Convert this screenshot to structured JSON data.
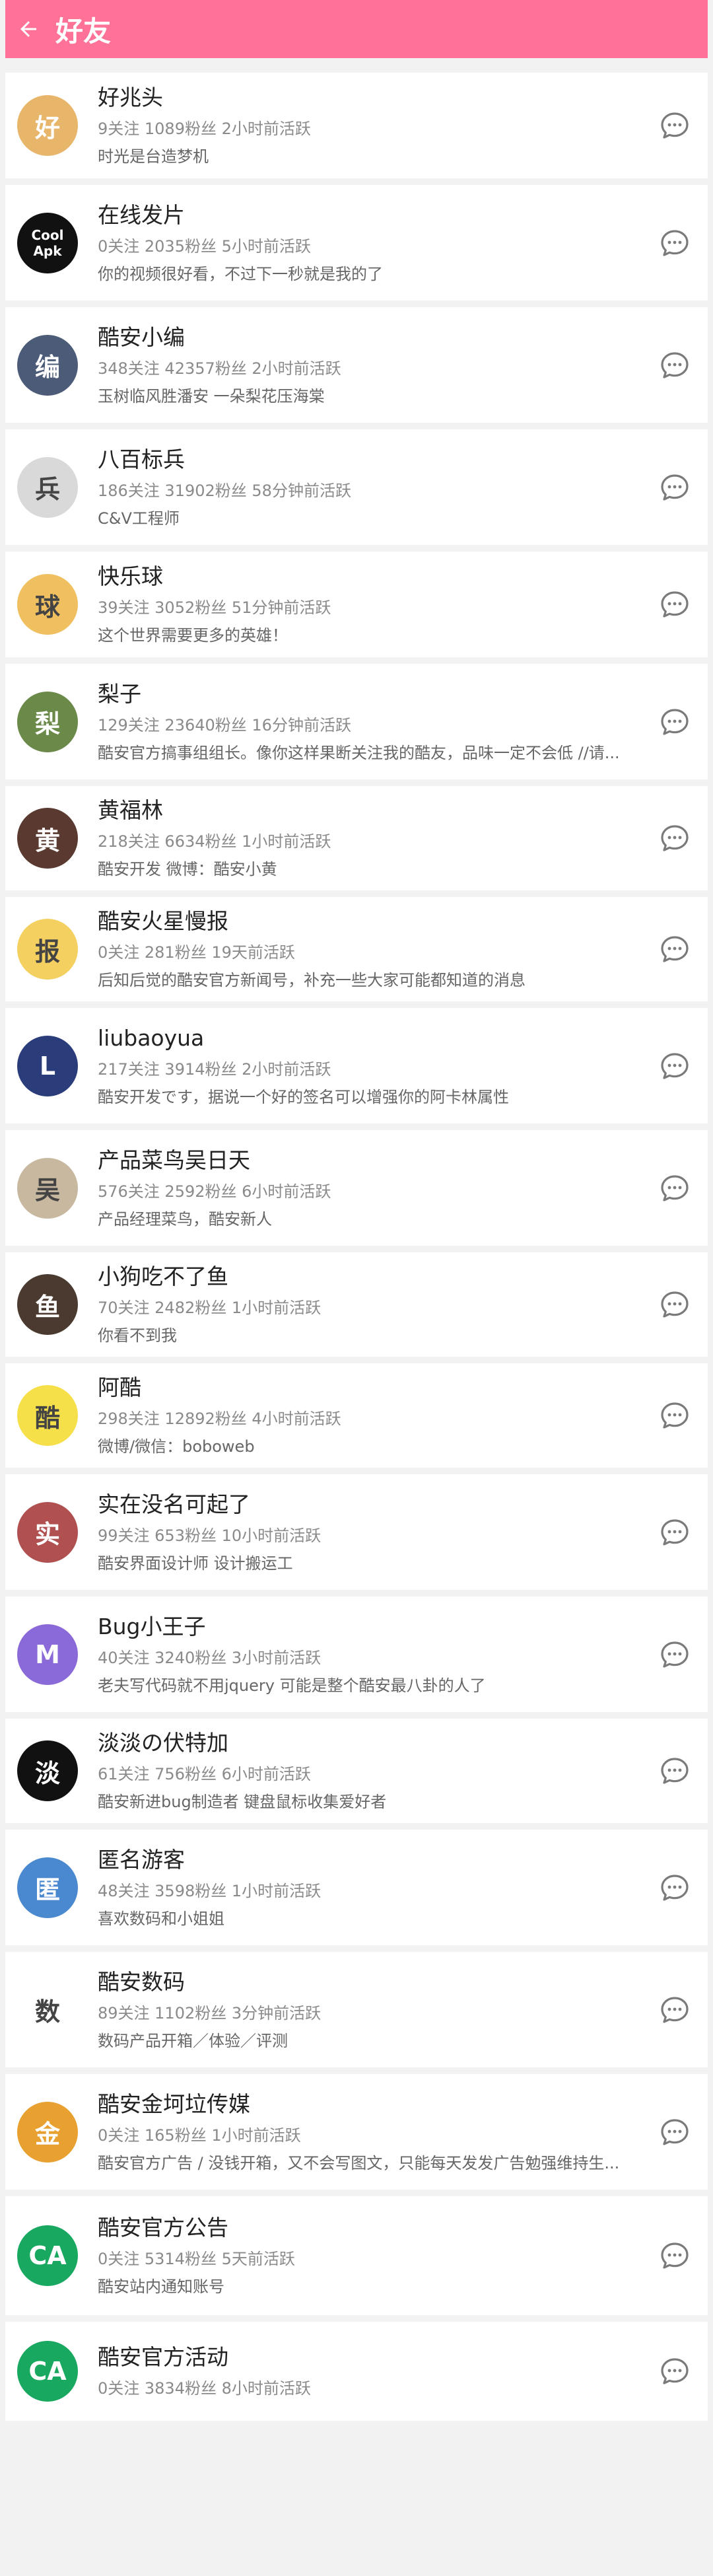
{
  "header": {
    "title": "好友",
    "bg_color": "#ff7298"
  },
  "friends": [
    {
      "name": "好兆头",
      "stats": "9关注 1089粉丝 2小时前活跃",
      "bio": "时光是台造梦机",
      "avatar_color": "#e8b66a",
      "avatar_text": "好"
    },
    {
      "name": "在线发片",
      "stats": "0关注 2035粉丝 5小时前活跃",
      "bio": "你的视频很好看，不过下一秒就是我的了",
      "avatar_color": "#111111",
      "avatar_text": "Cool Apk"
    },
    {
      "name": "酷安小编",
      "stats": "348关注 42357粉丝 2小时前活跃",
      "bio": "玉树临风胜潘安 一朵梨花压海棠",
      "avatar_color": "#4b5b78",
      "avatar_text": "编"
    },
    {
      "name": "八百标兵",
      "stats": "186关注 31902粉丝 58分钟前活跃",
      "bio": "C&V工程师",
      "avatar_color": "#d9d9d9",
      "avatar_text": "兵"
    },
    {
      "name": "快乐球",
      "stats": "39关注 3052粉丝 51分钟前活跃",
      "bio": "这个世界需要更多的英雄！",
      "avatar_color": "#f0c060",
      "avatar_text": "球"
    },
    {
      "name": "梨子",
      "stats": "129关注 23640粉丝 16分钟前活跃",
      "bio": "酷安官方搞事组组长。像你这样果断关注我的酷友，品味一定不会低 //请...",
      "avatar_color": "#6b8a4a",
      "avatar_text": "梨"
    },
    {
      "name": "黄福林",
      "stats": "218关注 6634粉丝 1小时前活跃",
      "bio": "酷安开发 微博：酷安小黄",
      "avatar_color": "#5a3a30",
      "avatar_text": "黄"
    },
    {
      "name": "酷安火星慢报",
      "stats": "0关注 281粉丝 19天前活跃",
      "bio": "后知后觉的酷安官方新闻号，补充一些大家可能都知道的消息",
      "avatar_color": "#f3d060",
      "avatar_text": "报"
    },
    {
      "name": "liubaoyua",
      "stats": "217关注 3914粉丝 2小时前活跃",
      "bio": "酷安开发です，据说一个好的签名可以增强你的阿卡林属性",
      "avatar_color": "#2a3c7a",
      "avatar_text": "L"
    },
    {
      "name": "产品菜鸟吴日天",
      "stats": "576关注 2592粉丝 6小时前活跃",
      "bio": "产品经理菜鸟，酷安新人",
      "avatar_color": "#c8b8a0",
      "avatar_text": "吴"
    },
    {
      "name": "小狗吃不了鱼",
      "stats": "70关注 2482粉丝 1小时前活跃",
      "bio": "你看不到我",
      "avatar_color": "#4a3a30",
      "avatar_text": "鱼"
    },
    {
      "name": "阿酷",
      "stats": "298关注 12892粉丝 4小时前活跃",
      "bio": "微博/微信：boboweb",
      "avatar_color": "#f5e04a",
      "avatar_text": "酷"
    },
    {
      "name": "实在没名可起了",
      "stats": "99关注 653粉丝 10小时前活跃",
      "bio": "酷安界面设计师 设计搬运工",
      "avatar_color": "#b05050",
      "avatar_text": "实"
    },
    {
      "name": "Bug小王子",
      "stats": "40关注 3240粉丝 3小时前活跃",
      "bio": "老夫写代码就不用jquery 可能是整个酷安最八卦的人了",
      "avatar_color": "#8a6ad8",
      "avatar_text": "M"
    },
    {
      "name": "淡淡の伏特加",
      "stats": "61关注 756粉丝 6小时前活跃",
      "bio": "酷安新进bug制造者 键盘鼠标收集爱好者",
      "avatar_color": "#111111",
      "avatar_text": "淡"
    },
    {
      "name": "匿名游客",
      "stats": "48关注 3598粉丝 1小时前活跃",
      "bio": "喜欢数码和小姐姐",
      "avatar_color": "#4a88d0",
      "avatar_text": "匿"
    },
    {
      "name": "酷安数码",
      "stats": "89关注 1102粉丝 3分钟前活跃",
      "bio": "数码产品开箱／体验／评测",
      "avatar_color": "#ffffff",
      "avatar_text": "数"
    },
    {
      "name": "酷安金坷垃传媒",
      "stats": "0关注 165粉丝 1小时前活跃",
      "bio": "酷安官方广告 / 没钱开箱，又不会写图文，只能每天发发广告勉强维持生...",
      "avatar_color": "#e8a030",
      "avatar_text": "金"
    },
    {
      "name": "酷安官方公告",
      "stats": "0关注 5314粉丝 5天前活跃",
      "bio": "酷安站内通知账号",
      "avatar_color": "#18a860",
      "avatar_text": "CA"
    },
    {
      "name": "酷安官方活动",
      "stats": "0关注 3834粉丝 8小时前活跃",
      "bio": "",
      "avatar_color": "#18a860",
      "avatar_text": "CA"
    }
  ]
}
